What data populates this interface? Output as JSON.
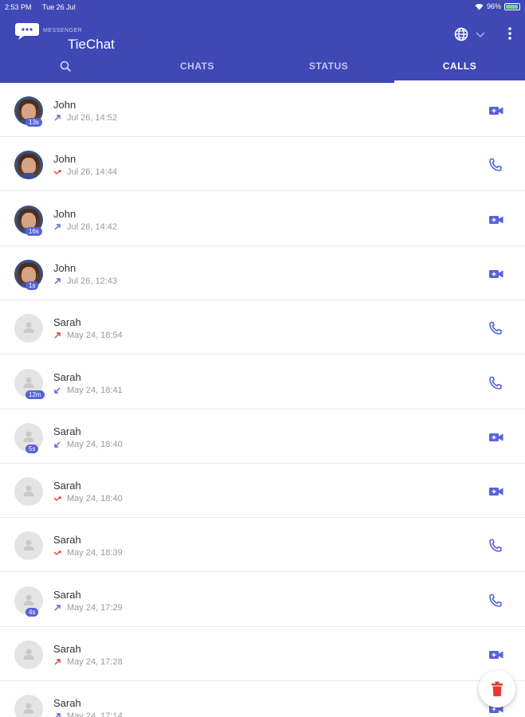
{
  "status": {
    "time": "2:53 PM",
    "date": "Tue 26 Jul",
    "battery": "96%"
  },
  "brand": {
    "name": "TieChat",
    "sub": "MESSENGER"
  },
  "tabs": [
    {
      "label": "CHATS"
    },
    {
      "label": "STATUS"
    },
    {
      "label": "CALLS",
      "active": true
    }
  ],
  "colors": {
    "primary": "#3f48b5",
    "accent": "#5663d8",
    "missed": "#e53935",
    "outgoing_red": "#e53935"
  },
  "calls": [
    {
      "name": "John",
      "time": "Jul 26, 14:52",
      "duration": "13s",
      "direction": "outgoing",
      "type": "video",
      "avatar": "photo"
    },
    {
      "name": "John",
      "time": "Jul 26, 14:44",
      "duration": "",
      "direction": "missed",
      "type": "voice",
      "avatar": "photo"
    },
    {
      "name": "John",
      "time": "Jul 26, 14:42",
      "duration": "16s",
      "direction": "outgoing",
      "type": "video",
      "avatar": "photo"
    },
    {
      "name": "John",
      "time": "Jul 26, 12:43",
      "duration": "1s",
      "direction": "outgoing",
      "type": "video",
      "avatar": "photo"
    },
    {
      "name": "Sarah",
      "time": "May 24, 18:54",
      "duration": "",
      "direction": "outgoing-red",
      "type": "voice",
      "avatar": "blank"
    },
    {
      "name": "Sarah",
      "time": "May 24, 18:41",
      "duration": "12m",
      "direction": "incoming",
      "type": "voice",
      "avatar": "blank"
    },
    {
      "name": "Sarah",
      "time": "May 24, 18:40",
      "duration": "5s",
      "direction": "incoming",
      "type": "video",
      "avatar": "blank"
    },
    {
      "name": "Sarah",
      "time": "May 24, 18:40",
      "duration": "",
      "direction": "missed",
      "type": "video",
      "avatar": "blank"
    },
    {
      "name": "Sarah",
      "time": "May 24, 18:39",
      "duration": "",
      "direction": "missed",
      "type": "voice",
      "avatar": "blank"
    },
    {
      "name": "Sarah",
      "time": "May 24, 17:29",
      "duration": "4s",
      "direction": "outgoing",
      "type": "voice",
      "avatar": "blank"
    },
    {
      "name": "Sarah",
      "time": "May 24, 17:28",
      "duration": "",
      "direction": "outgoing-red",
      "type": "video",
      "avatar": "blank"
    },
    {
      "name": "Sarah",
      "time": "May 24, 17:14",
      "duration": "",
      "direction": "outgoing",
      "type": "video",
      "avatar": "blank"
    }
  ],
  "icons": {
    "search": "search-icon",
    "globe": "globe-icon",
    "more": "more-vert-icon",
    "delete": "trash-icon"
  }
}
